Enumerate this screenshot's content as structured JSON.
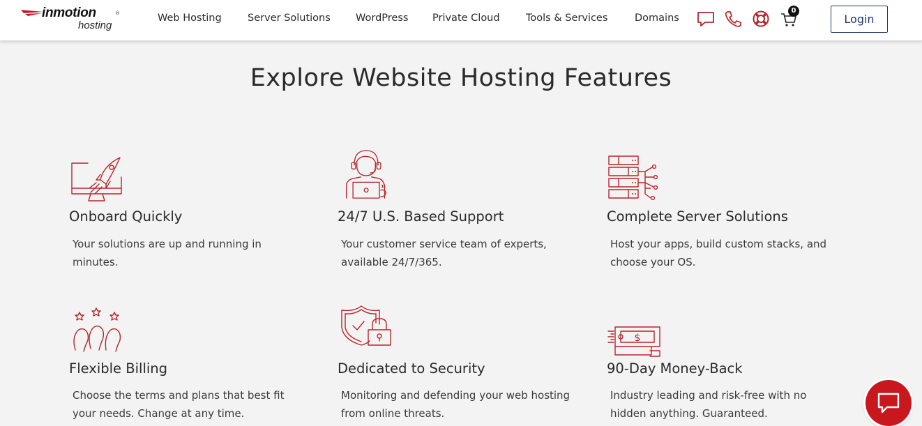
{
  "header": {
    "logo": {
      "top": "inmotion",
      "bottom": "hosting",
      "reg": "®"
    },
    "nav": [
      {
        "label": "Web Hosting"
      },
      {
        "label": "Server Solutions"
      },
      {
        "label": "WordPress"
      },
      {
        "label": "Private Cloud"
      },
      {
        "label": "Tools & Services"
      },
      {
        "label": "Domains"
      }
    ],
    "icons": [
      "chat-icon",
      "phone-icon",
      "support-lifebuoy-icon",
      "cart-icon"
    ],
    "cart_count": "0",
    "login_label": "Login"
  },
  "main": {
    "title": "Explore Website Hosting Features",
    "features": [
      {
        "icon": "rocket-monitor-icon",
        "title": "Onboard Quickly",
        "desc": "Your solutions are up and running in minutes."
      },
      {
        "icon": "support-agent-icon",
        "title": "24/7 U.S. Based Support",
        "desc": "Your customer service team of experts, available 24/7/365."
      },
      {
        "icon": "server-network-icon",
        "title": "Complete Server Solutions",
        "desc": "Host your apps, build custom stacks, and choose your OS."
      },
      {
        "icon": "users-stars-icon",
        "title": "Flexible Billing",
        "desc": "Choose the terms and plans that best fit your needs. Change at any time."
      },
      {
        "icon": "shield-lock-icon",
        "title": "Dedicated to Security",
        "desc": "Monitoring and defending your web hosting from online threats."
      },
      {
        "icon": "money-back-icon",
        "title": "90-Day Money-Back",
        "desc": "Industry leading and risk-free with no hidden anything. Guaranteed."
      }
    ]
  },
  "colors": {
    "accent": "#b5262b",
    "navy": "#1f3a66",
    "background": "#f4f3f3",
    "chat": "#c8181e"
  }
}
